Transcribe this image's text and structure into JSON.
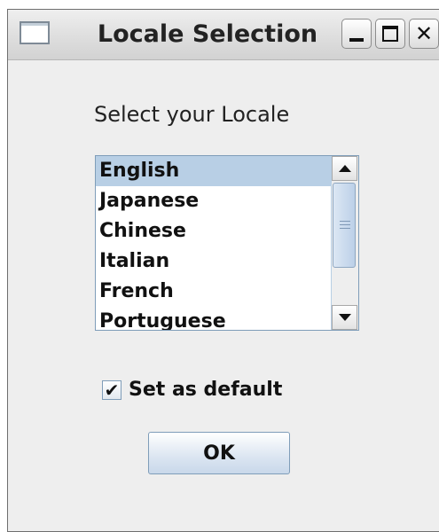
{
  "window": {
    "title": "Locale Selection",
    "controls": {
      "minimize_icon": "minimize-icon",
      "maximize_icon": "maximize-icon",
      "close_icon": "close-icon",
      "close_glyph": "✕"
    }
  },
  "prompt": "Select your Locale",
  "locale_list": {
    "items": [
      "English",
      "Japanese",
      "Chinese",
      "Italian",
      "French",
      "Portuguese"
    ],
    "selected": "English"
  },
  "set_default": {
    "label": "Set as default",
    "checked": true,
    "check_glyph": "✔"
  },
  "ok_button": {
    "label": "OK"
  },
  "colors": {
    "background": "#eeeeee",
    "selection": "#b8cfe5",
    "border": "#7f9db9"
  }
}
